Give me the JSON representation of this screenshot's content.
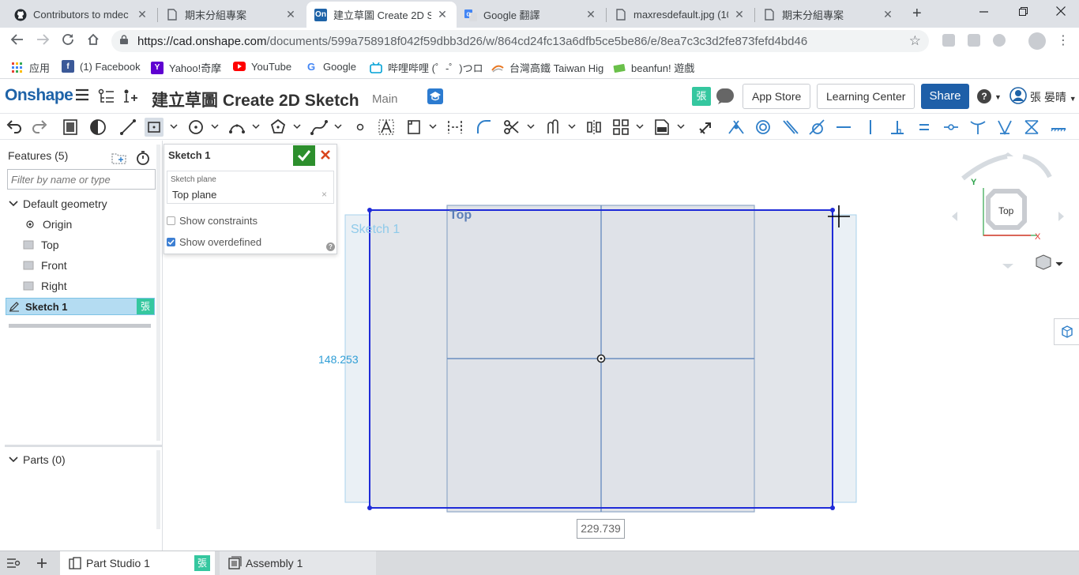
{
  "browser": {
    "tabs": [
      {
        "title": "Contributors to mdec",
        "icon": "github-icon"
      },
      {
        "title": "期末分組專案",
        "icon": "document-icon"
      },
      {
        "title": "建立草圖 Create 2D Sk",
        "icon": "onshape-icon",
        "fav_text": "On",
        "active": true
      },
      {
        "title": "Google 翻譯",
        "icon": "google-translate-icon"
      },
      {
        "title": "maxresdefault.jpg (10",
        "icon": "document-icon"
      },
      {
        "title": "期末分組專案",
        "icon": "document-icon"
      }
    ],
    "new_tab": "+",
    "url_host": "https://cad.onshape.com",
    "url_path": "/documents/599a758918f042f59dbb3d26/w/864cd24fc13a6dfb5ce5be86/e/8ea7c3c3d2fe873fefd4bd46",
    "bookmarks": [
      {
        "label": "应用",
        "icon": "apps-grid-icon"
      },
      {
        "label": "(1) Facebook",
        "icon": "facebook-icon",
        "fav_text": "f",
        "color": "#3b5998"
      },
      {
        "label": "Yahoo!奇摩",
        "icon": "yahoo-icon",
        "fav_text": "Y",
        "color": "#5f01d1"
      },
      {
        "label": "YouTube",
        "icon": "youtube-icon",
        "color": "#ff0000"
      },
      {
        "label": "Google",
        "icon": "google-icon",
        "fav_text": "G",
        "color": "#4285f4"
      },
      {
        "label": "哔哩哔哩 (゜-゜)つロ",
        "icon": "bilibili-icon",
        "color": "#00a1d6"
      },
      {
        "label": "台灣高鐵 Taiwan Hig",
        "icon": "thsr-icon",
        "color": "#e87722"
      },
      {
        "label": "beanfun! 遊戲",
        "icon": "beanfun-icon",
        "color": "#6ac04a"
      }
    ]
  },
  "header": {
    "logo": "Onshape",
    "document_title": "建立草圖 Create 2D Sketch",
    "workspace": "Main",
    "user_tag": "張",
    "app_store": "App Store",
    "learning_center": "Learning Center",
    "share": "Share",
    "help": "?",
    "user_name": "張 晏晴"
  },
  "features": {
    "title": "Features (5)",
    "filter_placeholder": "Filter by name or type",
    "default_geometry": "Default geometry",
    "items": [
      "Origin",
      "Top",
      "Front",
      "Right"
    ],
    "sketch": "Sketch 1",
    "sketch_user_tag": "張",
    "parts": "Parts (0)"
  },
  "sketch_dialog": {
    "title": "Sketch 1",
    "plane_label": "Sketch plane",
    "plane_value": "Top plane",
    "plane_clear": "×",
    "show_constraints": "Show constraints",
    "show_constraints_checked": false,
    "show_overdefined": "Show overdefined",
    "show_overdefined_checked": true,
    "help": "?"
  },
  "viewport": {
    "plane_label": "Top",
    "sketch_label": "Sketch 1",
    "dim_vertical": "148.253",
    "dim_horizontal": "229.739",
    "view_cube": "Top",
    "axis_x": "X",
    "axis_y": "Y"
  },
  "bottom_tabs": [
    {
      "label": "Part Studio 1",
      "icon": "part-studio-icon",
      "active": true,
      "user_tag": "張"
    },
    {
      "label": "Assembly 1",
      "icon": "assembly-icon",
      "active": false
    }
  ],
  "colors": {
    "onshape_blue": "#1e63a8",
    "share_blue": "#1e5fa8",
    "sketch_blue": "#1f2bd8",
    "dim_blue": "#2f9ed6",
    "user_green": "#35c79f",
    "ok_green": "#2d8f2d",
    "cancel_red": "#d9451c"
  }
}
